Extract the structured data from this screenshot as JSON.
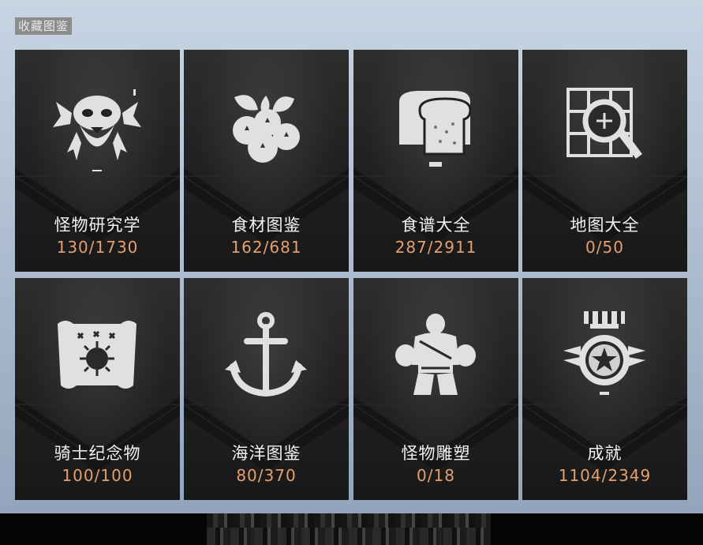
{
  "page": {
    "title": "收藏图鉴"
  },
  "cards": [
    {
      "label": "怪物研究学",
      "count": "130/1730",
      "icon": "monster-skull-icon"
    },
    {
      "label": "食材图鉴",
      "count": "162/681",
      "icon": "berries-icon"
    },
    {
      "label": "食谱大全",
      "count": "287/2911",
      "icon": "bread-icon"
    },
    {
      "label": "地图大全",
      "count": "0/50",
      "icon": "map-magnifier-icon"
    },
    {
      "label": "骑士纪念物",
      "count": "100/100",
      "icon": "banner-emblem-icon"
    },
    {
      "label": "海洋图鉴",
      "count": "80/370",
      "icon": "anchor-icon"
    },
    {
      "label": "怪物雕塑",
      "count": "0/18",
      "icon": "statue-icon"
    },
    {
      "label": "成就",
      "count": "1104/2349",
      "icon": "medal-star-icon"
    }
  ],
  "colors": {
    "count": "#e3a06e",
    "label": "#f2f2f2",
    "card_bg": "#202020",
    "icon": "#e0e0e0"
  }
}
